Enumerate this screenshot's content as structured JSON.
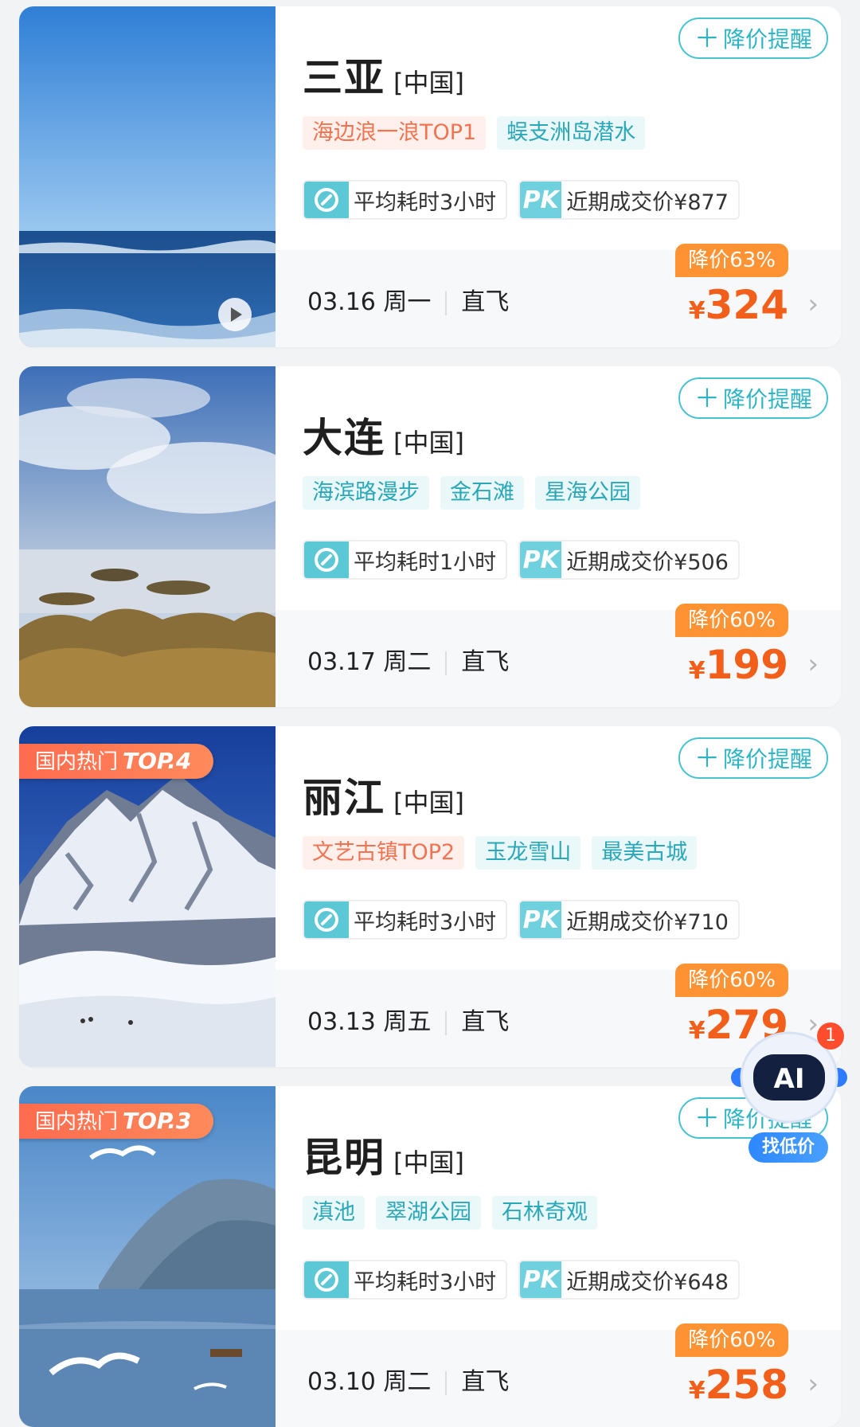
{
  "remind_label": "降价提醒",
  "cards": [
    {
      "city": "三亚",
      "country": "[中国]",
      "tags": [
        "海边浪一浪TOP1",
        "蜈支洲岛潜水"
      ],
      "avg_time": "平均耗时3小时",
      "pk_label": "PK",
      "recent_price": "近期成交价¥877",
      "date": "03.16 周一",
      "flight": "直飞",
      "discount": "降价63%",
      "currency": "¥",
      "price": "324"
    },
    {
      "city": "大连",
      "country": "[中国]",
      "tags": [
        "海滨路漫步",
        "金石滩",
        "星海公园"
      ],
      "avg_time": "平均耗时1小时",
      "pk_label": "PK",
      "recent_price": "近期成交价¥506",
      "date": "03.17 周二",
      "flight": "直飞",
      "discount": "降价60%",
      "currency": "¥",
      "price": "199"
    },
    {
      "city": "丽江",
      "country": "[中国]",
      "hot_badge": {
        "prefix": "国内热门",
        "rank": "TOP.4"
      },
      "tags": [
        "文艺古镇TOP2",
        "玉龙雪山",
        "最美古城"
      ],
      "avg_time": "平均耗时3小时",
      "pk_label": "PK",
      "recent_price": "近期成交价¥710",
      "date": "03.13 周五",
      "flight": "直飞",
      "discount": "降价60%",
      "currency": "¥",
      "price": "279"
    },
    {
      "city": "昆明",
      "country": "[中国]",
      "hot_badge": {
        "prefix": "国内热门",
        "rank": "TOP.3"
      },
      "tags": [
        "滇池",
        "翠湖公园",
        "石林奇观"
      ],
      "avg_time": "平均耗时3小时",
      "pk_label": "PK",
      "recent_price": "近期成交价¥648",
      "date": "03.10 周二",
      "flight": "直飞",
      "discount": "降价60%",
      "currency": "¥",
      "price": "258"
    }
  ],
  "ai_assistant": {
    "icon_text": "AI",
    "badge_count": "1",
    "label": "找低价"
  }
}
